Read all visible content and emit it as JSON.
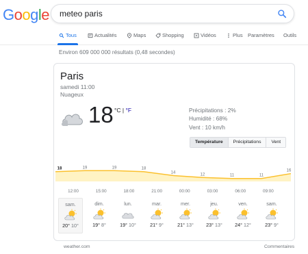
{
  "logo": [
    "G",
    "o",
    "o",
    "g",
    "l",
    "e"
  ],
  "logo_colors": [
    "#4285F4",
    "#EA4335",
    "#FBBC05",
    "#4285F4",
    "#34A853",
    "#EA4335"
  ],
  "search": {
    "query": "meteo paris",
    "icon": "search-icon"
  },
  "tabs": [
    {
      "label": "Tous",
      "icon": "search-icon",
      "active": true
    },
    {
      "label": "Actualités",
      "icon": "news-icon"
    },
    {
      "label": "Maps",
      "icon": "map-pin-icon"
    },
    {
      "label": "Shopping",
      "icon": "tag-icon"
    },
    {
      "label": "Vidéos",
      "icon": "play-icon"
    },
    {
      "label": "Plus",
      "icon": "more-vertical-icon"
    },
    {
      "label": "Paramètres"
    },
    {
      "label": "Outils"
    }
  ],
  "result_stats": "Environ 609 000 000 résultats (0,48 secondes)",
  "weather": {
    "location": "Paris",
    "datetime": "samedi 11:00",
    "condition": "Nuageux",
    "temperature": "18",
    "unit_c": "°C",
    "unit_sep": "|",
    "unit_f": "°F",
    "precipitation": "Précipitations : 2%",
    "humidity": "Humidité : 68%",
    "wind": "Vent : 10 km/h",
    "modes": [
      "Température",
      "Précipitations",
      "Vent"
    ],
    "selected_mode": "Température",
    "days": [
      {
        "name": "sam.",
        "hi": "20°",
        "lo": "10°",
        "icon": "partly-cloudy-icon"
      },
      {
        "name": "dim.",
        "hi": "19°",
        "lo": "8°",
        "icon": "partly-cloudy-icon"
      },
      {
        "name": "lun.",
        "hi": "19°",
        "lo": "10°",
        "icon": "cloudy-icon"
      },
      {
        "name": "mar.",
        "hi": "21°",
        "lo": "9°",
        "icon": "partly-cloudy-icon"
      },
      {
        "name": "mer.",
        "hi": "21°",
        "lo": "13°",
        "icon": "partly-cloudy-icon"
      },
      {
        "name": "jeu.",
        "hi": "23°",
        "lo": "13°",
        "icon": "partly-cloudy-icon"
      },
      {
        "name": "ven.",
        "hi": "24°",
        "lo": "12°",
        "icon": "partly-cloudy-icon"
      },
      {
        "name": "sam.",
        "hi": "23°",
        "lo": "9°",
        "icon": "partly-cloudy-icon"
      }
    ],
    "source": "weather.com",
    "feedback": "Commentaires"
  },
  "chart_data": {
    "type": "area",
    "x": [
      "12:00",
      "15:00",
      "18:00",
      "21:00",
      "00:00",
      "03:00",
      "06:00",
      "09:00"
    ],
    "values": [
      18,
      19,
      19,
      18,
      14,
      12,
      11,
      11,
      16
    ],
    "value_labels": [
      "18",
      "19",
      "19",
      "18",
      "14",
      "12",
      "11",
      "11",
      "16"
    ],
    "line_color": "#fbc02d",
    "fill_color": "#fff3c4"
  }
}
